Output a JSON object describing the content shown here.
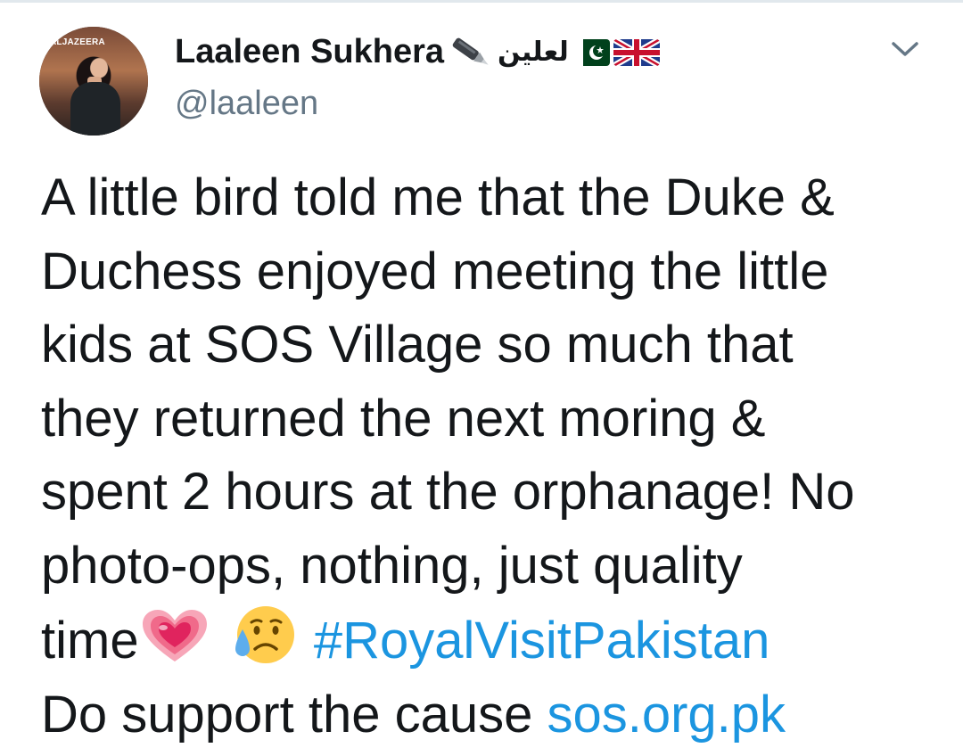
{
  "author": {
    "name": "Laaleen Sukhera",
    "urdu_name": "لعلین",
    "handle": "@laaleen",
    "avatar_label": "ALJAZEERA",
    "icons": [
      "fountain-pen-icon",
      "pakistan-flag-icon",
      "uk-flag-icon"
    ]
  },
  "menu": {
    "icon": "chevron-down-icon"
  },
  "tweet": {
    "lines": [
      "A little bird told me that the Duke &",
      "Duchess enjoyed meeting the little",
      "kids at SOS Village so much that",
      "they returned the next moring &",
      "spent 2 hours at the orphanage! No",
      "photo-ops, nothing, just quality"
    ],
    "last_word": "time",
    "emojis": [
      "growing-heart-icon",
      "sad-but-relieved-face-icon"
    ],
    "hashtag": "#RoyalVisitPakistan",
    "closing_text": "Do support the cause ",
    "link": "sos.org.pk"
  },
  "colors": {
    "link": "#1b95e0",
    "text": "#14171a",
    "muted": "#657786"
  }
}
